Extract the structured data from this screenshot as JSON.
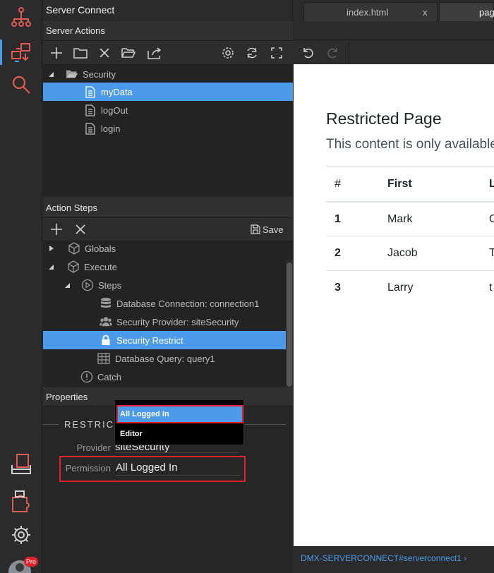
{
  "rail": {
    "badge": "Pro"
  },
  "panel": {
    "title": "Server Connect",
    "server_actions_title": "Server Actions",
    "tree": [
      {
        "label": "Security",
        "level": 0
      },
      {
        "label": "myData",
        "level": 1,
        "selected": true
      },
      {
        "label": "logOut",
        "level": 1
      },
      {
        "label": "login",
        "level": 1
      }
    ],
    "action_steps_title": "Action Steps",
    "save_label": "Save",
    "steps": [
      {
        "label": "Globals"
      },
      {
        "label": "Execute"
      },
      {
        "label": "Steps"
      },
      {
        "label": "Database Connection: connection1"
      },
      {
        "label": "Security Provider: siteSecurity"
      },
      {
        "label": "Security Restrict",
        "selected": true
      },
      {
        "label": "Database Query: query1"
      },
      {
        "label": "Catch"
      }
    ],
    "properties_title": "Properties",
    "section_title": "RESTRICT",
    "provider_label": "Provider",
    "provider_value": "siteSecurity",
    "permission_label": "Permission",
    "permission_value": "All Logged In",
    "dropdown_options": [
      "All Logged In",
      "Editor"
    ]
  },
  "editor": {
    "tabs": [
      {
        "label": "index.html"
      },
      {
        "label": "x"
      },
      {
        "label": "pag"
      }
    ],
    "doc": {
      "heading": "Restricted Page",
      "lead": "This content is only available",
      "table_headers": [
        "#",
        "First",
        "L"
      ],
      "table_rows": [
        [
          "1",
          "Mark",
          "O"
        ],
        [
          "2",
          "Jacob",
          "T"
        ],
        [
          "3",
          "Larry",
          "t"
        ]
      ]
    },
    "status_path": "DMX-SERVERCONNECT#serverconnect1",
    "status_chevron": "›"
  },
  "colors": {
    "accent": "#4c9bea",
    "highlight_red": "#e0202a",
    "rail_icon_active": "#e05a4f"
  }
}
